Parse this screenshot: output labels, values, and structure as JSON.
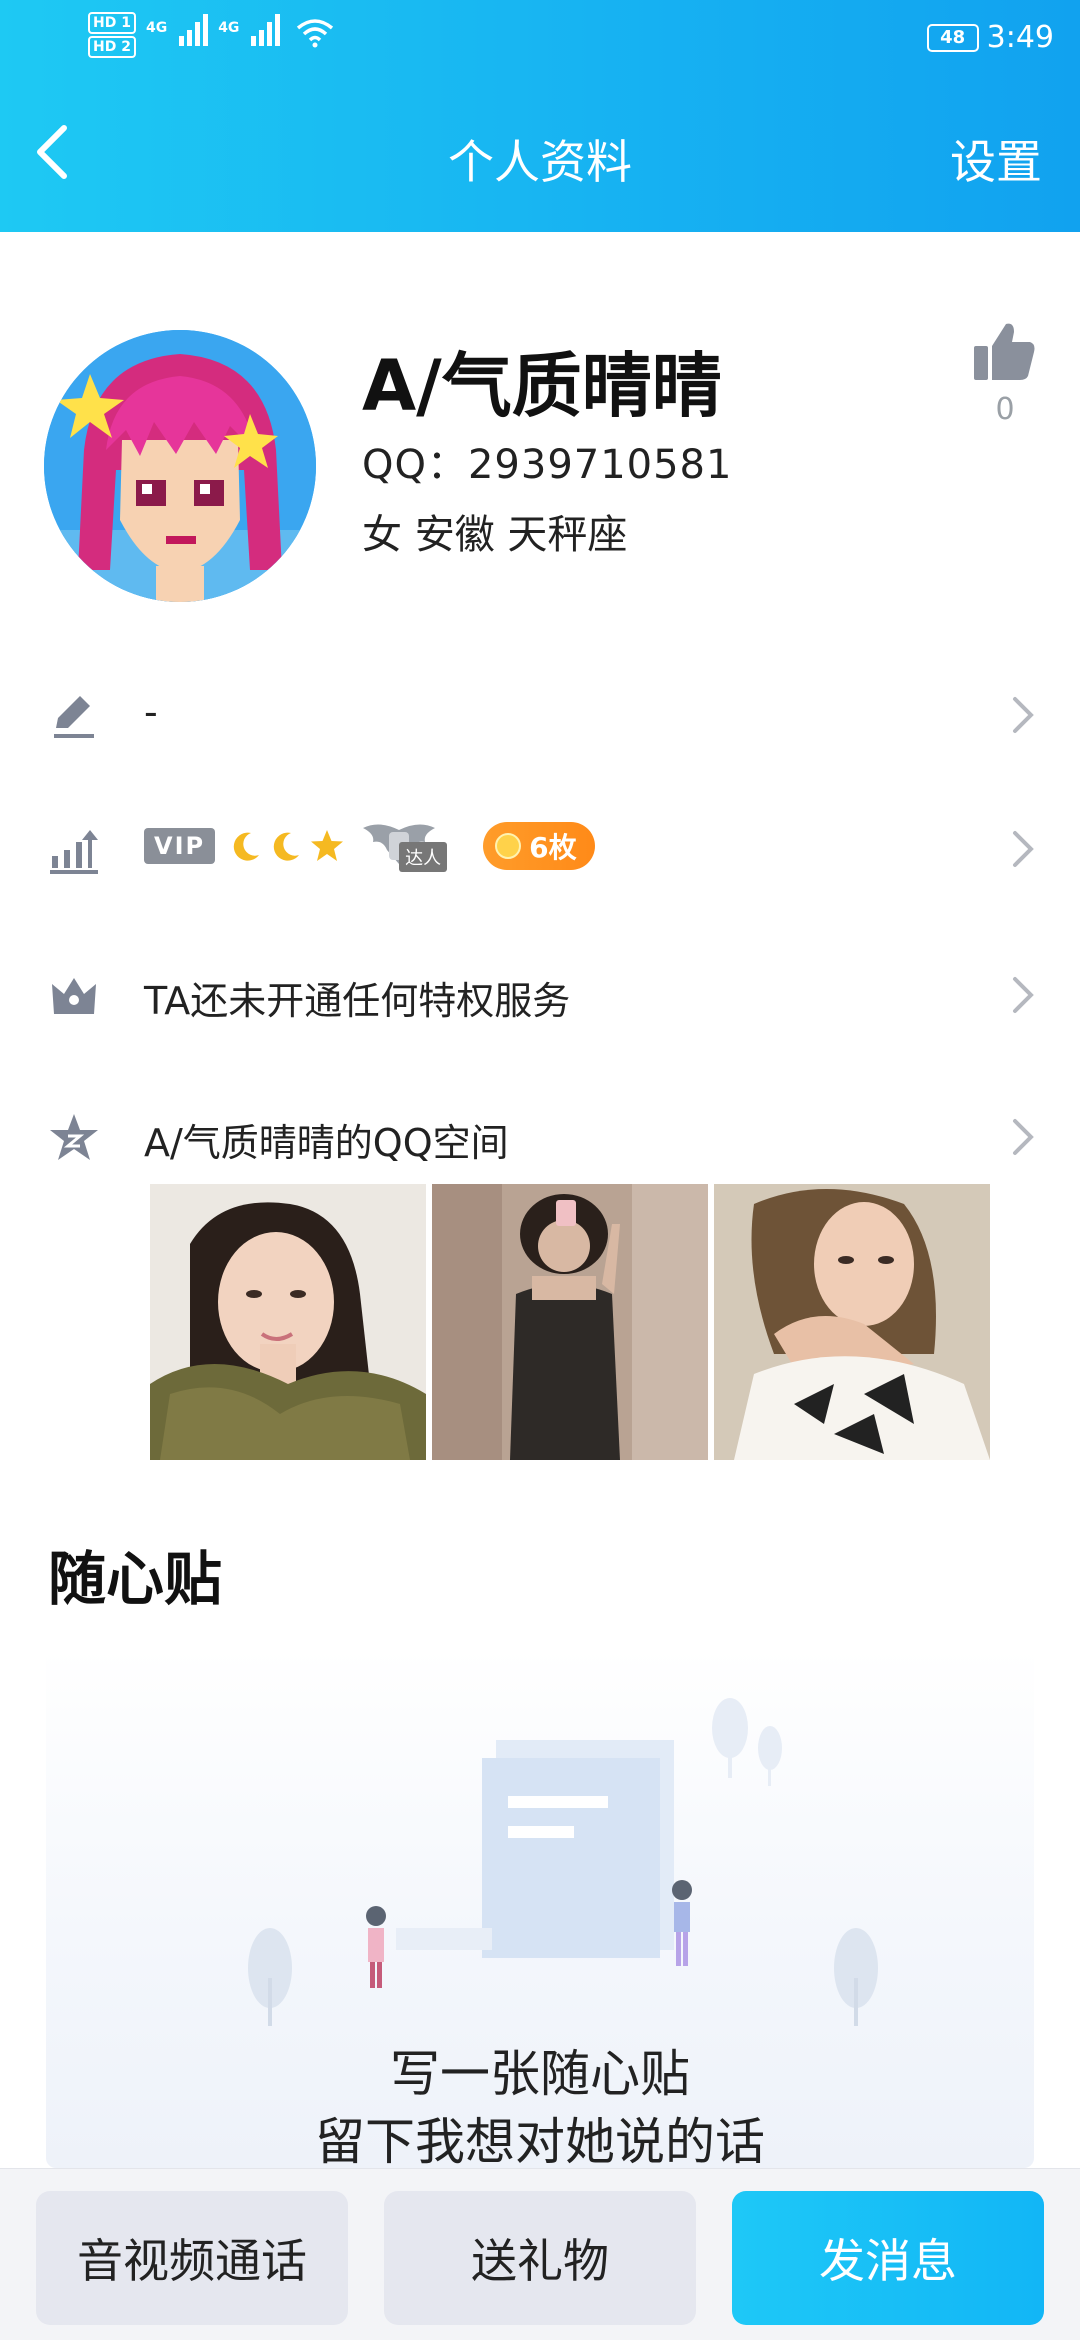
{
  "status_bar": {
    "hd1": "HD 1",
    "hd2": "HD 2",
    "net1": "4G",
    "net2": "4G",
    "battery": "48",
    "time": "3:49"
  },
  "nav": {
    "title": "个人资料",
    "settings": "设置"
  },
  "profile": {
    "name": "A/气质晴晴",
    "qq": "QQ：2939710581",
    "info": "女  安徽  天秤座",
    "likes": "0"
  },
  "rows": {
    "signature": "-",
    "vip_label": "VIP",
    "daren_label": "达人",
    "medal_count": "6枚",
    "privilege": "TA还未开通任何特权服务",
    "qzone": "A/气质晴晴的QQ空间"
  },
  "section": {
    "title": "随心贴",
    "line1": "写一张随心贴",
    "line2": "留下我想对她说的话"
  },
  "bottom_bar": {
    "call": "音视频通话",
    "gift": "送礼物",
    "message": "发消息"
  },
  "colors": {
    "header_start": "#1ec9f3",
    "header_end": "#11a2ef",
    "primary_button": "#12b6f6",
    "medal": "#ff9c2a"
  }
}
